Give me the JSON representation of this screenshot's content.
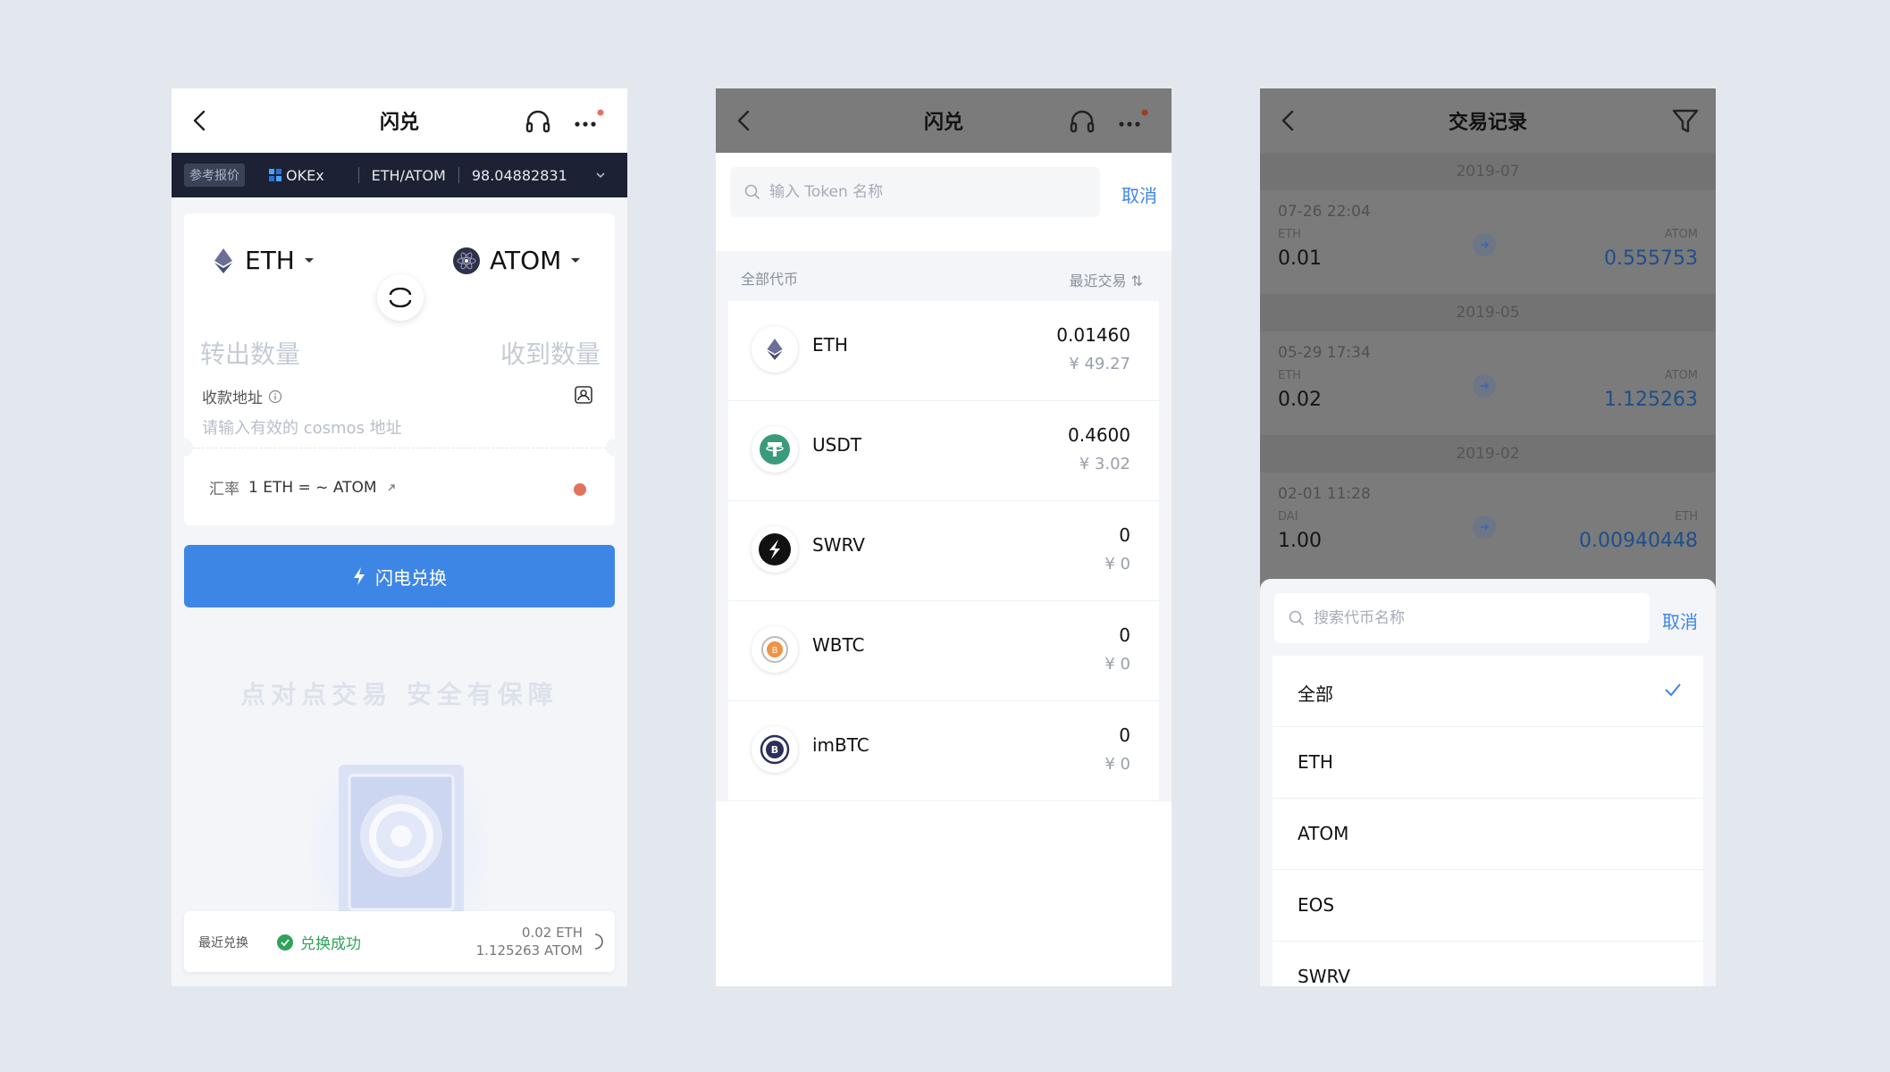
{
  "screen1": {
    "title": "闪兑",
    "ticker": {
      "tag": "参考报价",
      "exchange": "OKEx",
      "pair": "ETH/ATOM",
      "price": "98.04882831"
    },
    "from_coin": "ETH",
    "to_coin": "ATOM",
    "send_placeholder": "转出数量",
    "receive_placeholder": "收到数量",
    "address_label": "收款地址",
    "address_placeholder": "请输入有效的 cosmos 地址",
    "rate_label": "汇率",
    "rate_value": "1 ETH = ~ ATOM",
    "flash_button": "闪电兑换",
    "slogan": "点对点交易 安全有保障",
    "recent": {
      "label": "最近兑换",
      "status": "兑换成功",
      "from_amount": "0.02 ETH",
      "to_amount": "1.125263 ATOM"
    }
  },
  "screen2": {
    "title": "闪兑",
    "search_placeholder": "输入 Token 名称",
    "cancel": "取消",
    "section_left": "全部代币",
    "section_right": "最近交易 ⇅",
    "tokens": [
      {
        "name": "ETH",
        "balance": "0.01460",
        "fiat": "¥ 49.27"
      },
      {
        "name": "USDT",
        "balance": "0.4600",
        "fiat": "¥ 3.02"
      },
      {
        "name": "SWRV",
        "balance": "0",
        "fiat": "¥ 0"
      },
      {
        "name": "WBTC",
        "balance": "0",
        "fiat": "¥ 0"
      },
      {
        "name": "imBTC",
        "balance": "0",
        "fiat": "¥ 0"
      }
    ]
  },
  "screen3": {
    "title": "交易记录",
    "history": [
      {
        "month": "2019-07",
        "date": "07-26 22:04",
        "from_coin": "ETH",
        "from_amount": "0.01",
        "to_coin": "ATOM",
        "to_amount": "0.555753"
      },
      {
        "month": "2019-05",
        "date": "05-29 17:34",
        "from_coin": "ETH",
        "from_amount": "0.02",
        "to_coin": "ATOM",
        "to_amount": "1.125263"
      },
      {
        "month": "2019-02",
        "date": "02-01 11:28",
        "from_coin": "DAI",
        "from_amount": "1.00",
        "to_coin": "ETH",
        "to_amount": "0.00940448"
      }
    ],
    "search_placeholder": "搜索代币名称",
    "cancel": "取消",
    "filters": [
      "全部",
      "ETH",
      "ATOM",
      "EOS",
      "SWRV"
    ]
  },
  "colors": {
    "accent": "#3e86e6",
    "success": "#2fa35a",
    "dot": "#e2725b",
    "ticker_bg": "#1c2233"
  }
}
